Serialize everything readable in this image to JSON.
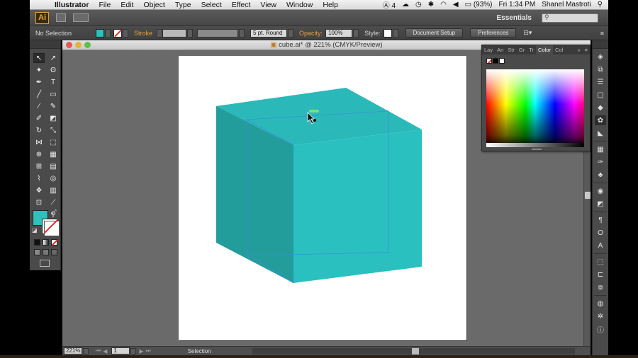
{
  "menubar": {
    "app_name": "Illustrator",
    "items": [
      "File",
      "Edit",
      "Object",
      "Type",
      "Select",
      "Effect",
      "View",
      "Window",
      "Help"
    ],
    "adobe_count": "4",
    "battery": "(93%)",
    "clock": "Fri 1:34 PM",
    "user": "Shanel Mastroti"
  },
  "appbar": {
    "logo": "Ai",
    "workspace": "Essentials"
  },
  "controlbar": {
    "selection": "No Selection",
    "stroke_label": "Stroke",
    "brush": "5 pt. Round",
    "opacity_label": "Opacity:",
    "opacity_value": "100%",
    "style_label": "Style:",
    "document_setup": "Document Setup",
    "preferences": "Preferences",
    "fill_color": "#2fbfbd"
  },
  "document": {
    "title": "cube.ai* @ 221% (CMYK/Preview)",
    "zoom": "221%",
    "artboard_number": "1",
    "status_tool": "Selection"
  },
  "colors": {
    "cube_top": "#2ab9b8",
    "cube_left": "#239c9c",
    "cube_front": "#2bc0c0",
    "guide": "#3b8fd8",
    "fill": "#2fbfbd"
  },
  "color_panel": {
    "tabs": [
      "Lay",
      "An",
      "Str",
      "Gr",
      "Tr",
      "Color",
      "Col"
    ]
  },
  "tools": [
    {
      "name": "selection-tool",
      "glyph": "↖"
    },
    {
      "name": "direct-selection-tool",
      "glyph": "↗"
    },
    {
      "name": "magic-wand-tool",
      "glyph": "✦"
    },
    {
      "name": "lasso-tool",
      "glyph": "ʘ"
    },
    {
      "name": "pen-tool",
      "glyph": "✒"
    },
    {
      "name": "type-tool",
      "glyph": "T"
    },
    {
      "name": "line-tool",
      "glyph": "╱"
    },
    {
      "name": "rectangle-tool",
      "glyph": "▭"
    },
    {
      "name": "paintbrush-tool",
      "glyph": "⁄"
    },
    {
      "name": "pencil-tool",
      "glyph": "✎"
    },
    {
      "name": "blob-brush-tool",
      "glyph": "✐"
    },
    {
      "name": "eraser-tool",
      "glyph": "◩"
    },
    {
      "name": "rotate-tool",
      "glyph": "↻"
    },
    {
      "name": "scale-tool",
      "glyph": "⤡"
    },
    {
      "name": "width-tool",
      "glyph": "⋈"
    },
    {
      "name": "free-transform-tool",
      "glyph": "⬚"
    },
    {
      "name": "shape-builder-tool",
      "glyph": "⊕"
    },
    {
      "name": "perspective-grid-tool",
      "glyph": "▦"
    },
    {
      "name": "mesh-tool",
      "glyph": "⊞"
    },
    {
      "name": "gradient-tool",
      "glyph": "▤"
    },
    {
      "name": "eyedropper-tool",
      "glyph": "⌇"
    },
    {
      "name": "blend-tool",
      "glyph": "◎"
    },
    {
      "name": "symbol-sprayer-tool",
      "glyph": "❖"
    },
    {
      "name": "column-graph-tool",
      "glyph": "▥"
    },
    {
      "name": "artboard-tool",
      "glyph": "⊡"
    },
    {
      "name": "slice-tool",
      "glyph": "⟋"
    },
    {
      "name": "hand-tool",
      "glyph": "✋"
    },
    {
      "name": "zoom-tool",
      "glyph": "⚲"
    }
  ]
}
